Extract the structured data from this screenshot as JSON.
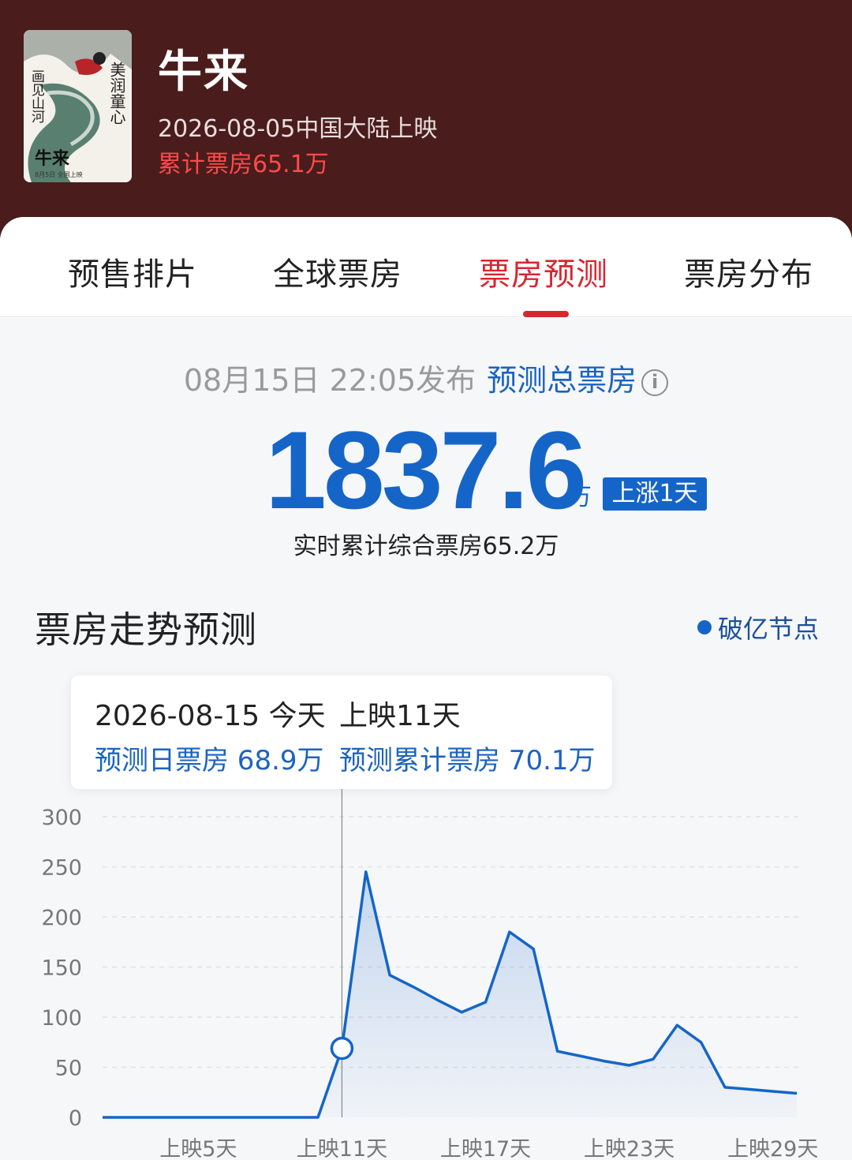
{
  "header": {
    "title": "牛来",
    "release": "2026-08-05中国大陆上映",
    "cumulative": "累计票房65.1万",
    "poster_text": [
      "美润童心",
      "画见山河",
      "牛来",
      "8月5日 全国上映"
    ]
  },
  "tabs": [
    {
      "label": "预售排片",
      "active": false
    },
    {
      "label": "全球票房",
      "active": false
    },
    {
      "label": "票房预测",
      "active": true
    },
    {
      "label": "票房分布",
      "active": false
    }
  ],
  "forecast": {
    "publish_time": "08月15日 22:05发布",
    "label": "预测总票房",
    "info_icon": "ⓘ",
    "total": "1837.6",
    "unit": "万",
    "badge": "上涨1天",
    "realtime": "实时累计综合票房65.2万"
  },
  "trend": {
    "title": "票房走势预测",
    "legend": "破亿节点"
  },
  "tooltip": {
    "date": "2026-08-15 今天",
    "day": "上映11天",
    "daily": "预测日票房 68.9万",
    "cumulative": "预测累计票房 70.1万"
  },
  "colors": {
    "header_bg": "#4a1c1c",
    "accent_red": "#d8262f",
    "blue": "#1565c8"
  },
  "chart_data": {
    "type": "area",
    "ylim": [
      0,
      300
    ],
    "yticks": [
      0,
      50,
      100,
      150,
      200,
      250,
      300
    ],
    "x_tick_labels": [
      "上映5天",
      "上映11天",
      "上映17天",
      "上映23天",
      "上映29天"
    ],
    "x_tick_days": [
      5,
      11,
      17,
      23,
      29
    ],
    "grid": true,
    "highlight_day": 11,
    "series": [
      {
        "x": [
          1,
          2,
          3,
          4,
          5,
          6,
          7,
          8,
          9,
          10,
          11,
          12,
          13,
          14,
          15,
          16,
          17,
          18,
          19,
          20,
          21,
          22,
          23,
          24,
          25,
          26,
          27,
          28,
          29,
          30
        ],
        "values": [
          0,
          0,
          0,
          0,
          0,
          0,
          0,
          0,
          0,
          0,
          68.9,
          245,
          142,
          130,
          117,
          105,
          115,
          185,
          168,
          66,
          61,
          56,
          52,
          58,
          92,
          75,
          30,
          28,
          26,
          24
        ]
      }
    ]
  }
}
